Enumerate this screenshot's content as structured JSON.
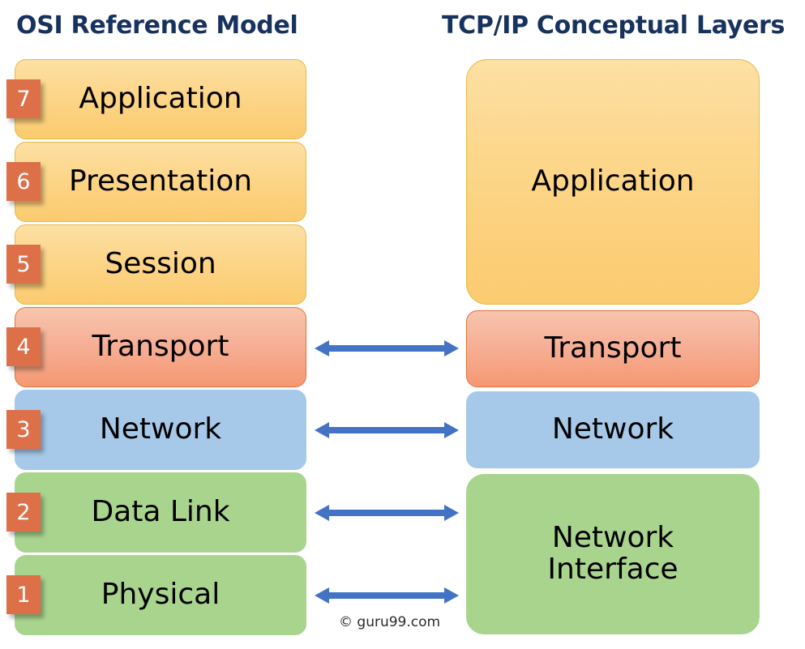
{
  "titles": {
    "left": "OSI Reference Model",
    "right": "TCP/IP Conceptual Layers"
  },
  "colors": {
    "title_navy": "#17325E",
    "badge_orange": "#DE7049",
    "arrow_blue": "#4472C4",
    "yellow": "#FCD68A",
    "salmon": "#F6B097",
    "blue": "#A6C9E9",
    "green": "#A9D48E"
  },
  "osi_layers": [
    {
      "number": "7",
      "label": "Application",
      "color": "yellow"
    },
    {
      "number": "6",
      "label": "Presentation",
      "color": "yellow"
    },
    {
      "number": "5",
      "label": "Session",
      "color": "yellow"
    },
    {
      "number": "4",
      "label": "Transport",
      "color": "salmon"
    },
    {
      "number": "3",
      "label": "Network",
      "color": "blue"
    },
    {
      "number": "2",
      "label": "Data Link",
      "color": "green"
    },
    {
      "number": "1",
      "label": "Physical",
      "color": "green"
    }
  ],
  "tcpip_layers": [
    {
      "label": "Application",
      "color": "yellow"
    },
    {
      "label": "Transport",
      "color": "salmon"
    },
    {
      "label": "Network",
      "color": "blue"
    },
    {
      "label": "Network Interface",
      "color": "green"
    }
  ],
  "mappings": [
    {
      "from": "Transport",
      "to": "Transport"
    },
    {
      "from": "Network",
      "to": "Network"
    },
    {
      "from": "Data Link",
      "to": "Network Interface"
    },
    {
      "from": "Physical",
      "to": "Network Interface"
    }
  ],
  "watermark": "© guru99.com"
}
